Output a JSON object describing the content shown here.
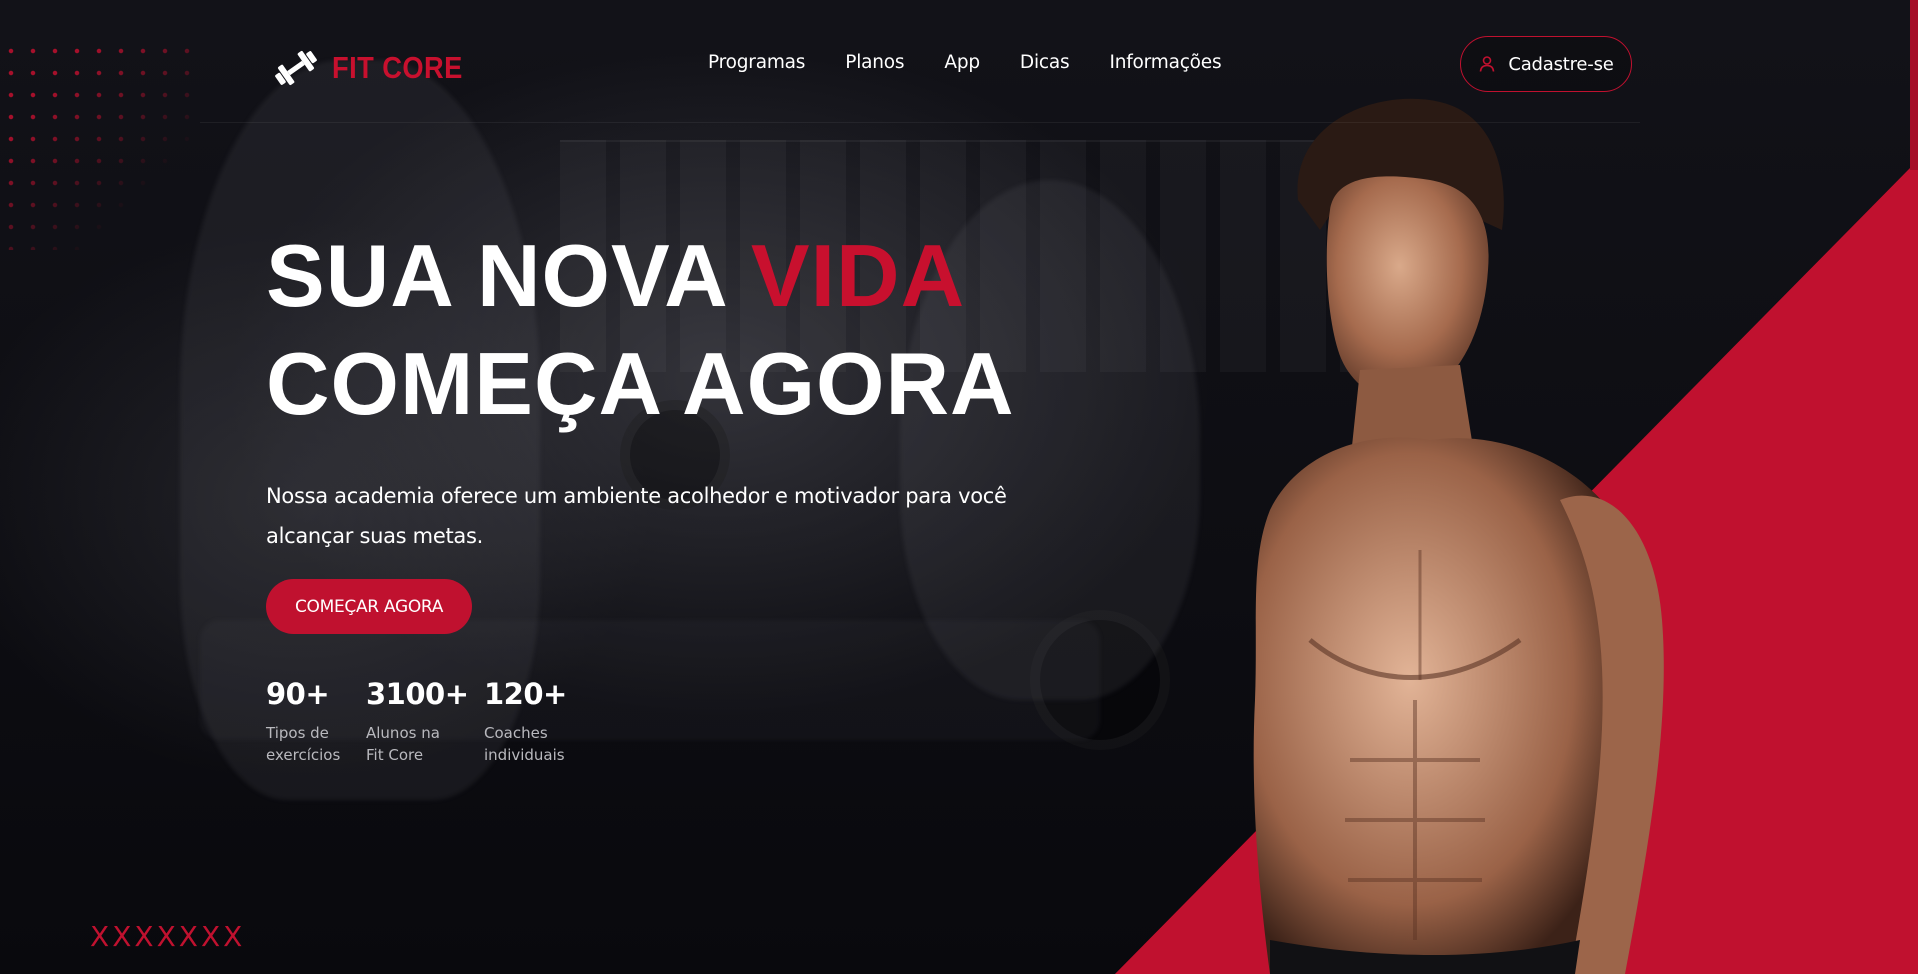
{
  "brand": {
    "name": "FIT CORE",
    "accent_color": "#c0112f",
    "logo_icon": "dumbbell-icon"
  },
  "nav": {
    "items": [
      {
        "label": "Programas"
      },
      {
        "label": "Planos"
      },
      {
        "label": "App"
      },
      {
        "label": "Dicas"
      },
      {
        "label": "Informações"
      }
    ]
  },
  "header": {
    "signup_label": "Cadastre-se",
    "signup_icon": "user-icon"
  },
  "hero": {
    "title_part1": "SUA NOVA ",
    "title_accent": "VIDA",
    "title_line2": "COMEÇA AGORA",
    "description": "Nossa academia oferece um ambiente acolhedor e motivador para você alcançar suas metas.",
    "cta_label": "COMEÇAR AGORA"
  },
  "stats": [
    {
      "value": "90+",
      "label": "Tipos de\nexercícios"
    },
    {
      "value": "3100+",
      "label": "Alunos na\nFit Core"
    },
    {
      "value": "120+",
      "label": "Coaches\nindividuais"
    }
  ],
  "decor": {
    "x_marks": [
      "X",
      "X",
      "X",
      "X",
      "X",
      "X",
      "X"
    ]
  }
}
